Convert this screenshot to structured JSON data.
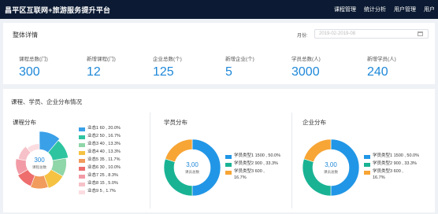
{
  "header": {
    "title": "昌平区互联网+旅游服务提升平台",
    "nav": [
      "课程管理",
      "统计分析",
      "用户管理",
      "用户"
    ]
  },
  "overview": {
    "title": "整体详情",
    "month_label": "月份:",
    "month_value": "2019-02-2019-08",
    "stats": [
      {
        "label": "课程总数(门)",
        "value": "300"
      },
      {
        "label": "新增课程(门)",
        "value": "12"
      },
      {
        "label": "企业总数(个)",
        "value": "125"
      },
      {
        "label": "新增企业(个)",
        "value": "5"
      },
      {
        "label": "学员总数(人)",
        "value": "3000"
      },
      {
        "label": "新增学员(人)",
        "value": "240"
      }
    ]
  },
  "distribution": {
    "title": "课程、学员、企业分布情况",
    "panels": [
      {
        "title": "课程分布",
        "center_value": "300",
        "center_label": "课程总数",
        "chart_type": "rose",
        "legend": [
          {
            "name": "业态1",
            "text": "60 , 20.0%",
            "color": "#3aa0e8"
          },
          {
            "name": "业态2",
            "text": "50 , 16.7%",
            "color": "#2ec4a0"
          },
          {
            "name": "业态3",
            "text": "40 , 13.3%",
            "color": "#8fd6a8"
          },
          {
            "name": "业态4",
            "text": "40 , 13.3%",
            "color": "#f5c242"
          },
          {
            "name": "业态5",
            "text": "35 , 11.7%",
            "color": "#f19b5c"
          },
          {
            "name": "业态6",
            "text": "30 , 10.0%",
            "color": "#ee6e6e"
          },
          {
            "name": "业态7",
            "text": "25 , 8.3%",
            "color": "#f29ba6"
          },
          {
            "name": "业态8",
            "text": "15 , 5.0%",
            "color": "#f6c1c8"
          },
          {
            "name": "业态9",
            "text": "5 , 1.7%",
            "color": "#fbdde1"
          }
        ]
      },
      {
        "title": "学员分布",
        "center_value": "3,00",
        "center_label": "课员总数",
        "chart_type": "donut",
        "legend": [
          {
            "name": "学员类型1",
            "text": "1500 , 50.0%",
            "color": "#2196e6"
          },
          {
            "name": "学员类型2",
            "text": "900 , 33.3%",
            "color": "#19b394"
          },
          {
            "name": "学员类型3",
            "text": "600 ,",
            "text2": "16.7%",
            "color": "#f7a535"
          }
        ]
      },
      {
        "title": "企业分布",
        "center_value": "3,00",
        "center_label": "课员总数",
        "chart_type": "donut",
        "legend": [
          {
            "name": "学员类型1",
            "text": "1500 , 50.0%",
            "color": "#2196e6"
          },
          {
            "name": "学员类型2",
            "text": "900 , 33.3%",
            "color": "#19b394"
          },
          {
            "name": "学员类型3",
            "text": "600 ,",
            "text2": "16.7%",
            "color": "#f7a535"
          }
        ]
      }
    ]
  },
  "chart_data": [
    {
      "type": "pie",
      "title": "课程分布",
      "categories": [
        "业态1",
        "业态2",
        "业态3",
        "业态4",
        "业态5",
        "业态6",
        "业态7",
        "业态8",
        "业态9"
      ],
      "values": [
        60,
        50,
        40,
        40,
        35,
        30,
        25,
        15,
        5
      ]
    },
    {
      "type": "pie",
      "title": "学员分布",
      "categories": [
        "学员类型1",
        "学员类型2",
        "学员类型3"
      ],
      "values": [
        1500,
        900,
        600
      ]
    },
    {
      "type": "pie",
      "title": "企业分布",
      "categories": [
        "学员类型1",
        "学员类型2",
        "学员类型3"
      ],
      "values": [
        1500,
        900,
        600
      ]
    }
  ]
}
